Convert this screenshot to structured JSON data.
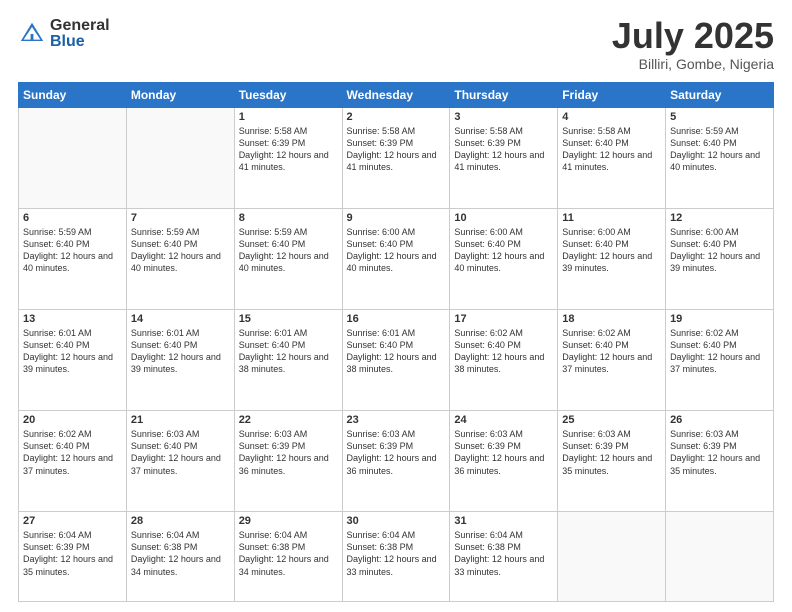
{
  "header": {
    "logo_general": "General",
    "logo_blue": "Blue",
    "month_title": "July 2025",
    "location": "Billiri, Gombe, Nigeria"
  },
  "days_of_week": [
    "Sunday",
    "Monday",
    "Tuesday",
    "Wednesday",
    "Thursday",
    "Friday",
    "Saturday"
  ],
  "weeks": [
    [
      {
        "day": "",
        "info": ""
      },
      {
        "day": "",
        "info": ""
      },
      {
        "day": "1",
        "info": "Sunrise: 5:58 AM\nSunset: 6:39 PM\nDaylight: 12 hours and 41 minutes."
      },
      {
        "day": "2",
        "info": "Sunrise: 5:58 AM\nSunset: 6:39 PM\nDaylight: 12 hours and 41 minutes."
      },
      {
        "day": "3",
        "info": "Sunrise: 5:58 AM\nSunset: 6:39 PM\nDaylight: 12 hours and 41 minutes."
      },
      {
        "day": "4",
        "info": "Sunrise: 5:58 AM\nSunset: 6:40 PM\nDaylight: 12 hours and 41 minutes."
      },
      {
        "day": "5",
        "info": "Sunrise: 5:59 AM\nSunset: 6:40 PM\nDaylight: 12 hours and 40 minutes."
      }
    ],
    [
      {
        "day": "6",
        "info": "Sunrise: 5:59 AM\nSunset: 6:40 PM\nDaylight: 12 hours and 40 minutes."
      },
      {
        "day": "7",
        "info": "Sunrise: 5:59 AM\nSunset: 6:40 PM\nDaylight: 12 hours and 40 minutes."
      },
      {
        "day": "8",
        "info": "Sunrise: 5:59 AM\nSunset: 6:40 PM\nDaylight: 12 hours and 40 minutes."
      },
      {
        "day": "9",
        "info": "Sunrise: 6:00 AM\nSunset: 6:40 PM\nDaylight: 12 hours and 40 minutes."
      },
      {
        "day": "10",
        "info": "Sunrise: 6:00 AM\nSunset: 6:40 PM\nDaylight: 12 hours and 40 minutes."
      },
      {
        "day": "11",
        "info": "Sunrise: 6:00 AM\nSunset: 6:40 PM\nDaylight: 12 hours and 39 minutes."
      },
      {
        "day": "12",
        "info": "Sunrise: 6:00 AM\nSunset: 6:40 PM\nDaylight: 12 hours and 39 minutes."
      }
    ],
    [
      {
        "day": "13",
        "info": "Sunrise: 6:01 AM\nSunset: 6:40 PM\nDaylight: 12 hours and 39 minutes."
      },
      {
        "day": "14",
        "info": "Sunrise: 6:01 AM\nSunset: 6:40 PM\nDaylight: 12 hours and 39 minutes."
      },
      {
        "day": "15",
        "info": "Sunrise: 6:01 AM\nSunset: 6:40 PM\nDaylight: 12 hours and 38 minutes."
      },
      {
        "day": "16",
        "info": "Sunrise: 6:01 AM\nSunset: 6:40 PM\nDaylight: 12 hours and 38 minutes."
      },
      {
        "day": "17",
        "info": "Sunrise: 6:02 AM\nSunset: 6:40 PM\nDaylight: 12 hours and 38 minutes."
      },
      {
        "day": "18",
        "info": "Sunrise: 6:02 AM\nSunset: 6:40 PM\nDaylight: 12 hours and 37 minutes."
      },
      {
        "day": "19",
        "info": "Sunrise: 6:02 AM\nSunset: 6:40 PM\nDaylight: 12 hours and 37 minutes."
      }
    ],
    [
      {
        "day": "20",
        "info": "Sunrise: 6:02 AM\nSunset: 6:40 PM\nDaylight: 12 hours and 37 minutes."
      },
      {
        "day": "21",
        "info": "Sunrise: 6:03 AM\nSunset: 6:40 PM\nDaylight: 12 hours and 37 minutes."
      },
      {
        "day": "22",
        "info": "Sunrise: 6:03 AM\nSunset: 6:39 PM\nDaylight: 12 hours and 36 minutes."
      },
      {
        "day": "23",
        "info": "Sunrise: 6:03 AM\nSunset: 6:39 PM\nDaylight: 12 hours and 36 minutes."
      },
      {
        "day": "24",
        "info": "Sunrise: 6:03 AM\nSunset: 6:39 PM\nDaylight: 12 hours and 36 minutes."
      },
      {
        "day": "25",
        "info": "Sunrise: 6:03 AM\nSunset: 6:39 PM\nDaylight: 12 hours and 35 minutes."
      },
      {
        "day": "26",
        "info": "Sunrise: 6:03 AM\nSunset: 6:39 PM\nDaylight: 12 hours and 35 minutes."
      }
    ],
    [
      {
        "day": "27",
        "info": "Sunrise: 6:04 AM\nSunset: 6:39 PM\nDaylight: 12 hours and 35 minutes."
      },
      {
        "day": "28",
        "info": "Sunrise: 6:04 AM\nSunset: 6:38 PM\nDaylight: 12 hours and 34 minutes."
      },
      {
        "day": "29",
        "info": "Sunrise: 6:04 AM\nSunset: 6:38 PM\nDaylight: 12 hours and 34 minutes."
      },
      {
        "day": "30",
        "info": "Sunrise: 6:04 AM\nSunset: 6:38 PM\nDaylight: 12 hours and 33 minutes."
      },
      {
        "day": "31",
        "info": "Sunrise: 6:04 AM\nSunset: 6:38 PM\nDaylight: 12 hours and 33 minutes."
      },
      {
        "day": "",
        "info": ""
      },
      {
        "day": "",
        "info": ""
      }
    ]
  ]
}
